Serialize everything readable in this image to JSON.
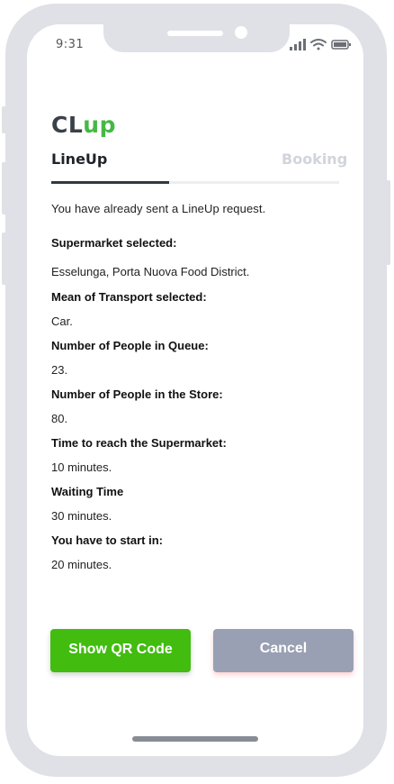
{
  "status_bar": {
    "time": "9:31",
    "icons": [
      "signal-icon",
      "wifi-icon",
      "battery-icon"
    ]
  },
  "app": {
    "logo_left": "CL",
    "logo_right": "up",
    "brand_dark": "#3a4148",
    "brand_green": "#44b944"
  },
  "tabs": [
    {
      "label": "LineUp",
      "active": true
    },
    {
      "label": "Booking",
      "active": false
    }
  ],
  "intro": "You have already sent a LineUp request.",
  "fields": [
    {
      "label": "Supermarket selected:",
      "value": "Esselunga, Porta Nuova Food District."
    },
    {
      "label": "Mean of Transport selected:",
      "value": "Car."
    },
    {
      "label": "Number of People in Queue:",
      "value": "23."
    },
    {
      "label": "Number of People in the Store:",
      "value": "80."
    },
    {
      "label": "Time to reach the Supermarket:",
      "value": "10 minutes."
    },
    {
      "label": "Waiting Time",
      "value": "30 minutes."
    },
    {
      "label": "You have to start in:",
      "value": "20 minutes."
    }
  ],
  "buttons": {
    "qr_label": "Show QR Code",
    "cancel_label": "Cancel",
    "qr_color": "#41bc0f",
    "cancel_color": "#9aa0b3"
  }
}
